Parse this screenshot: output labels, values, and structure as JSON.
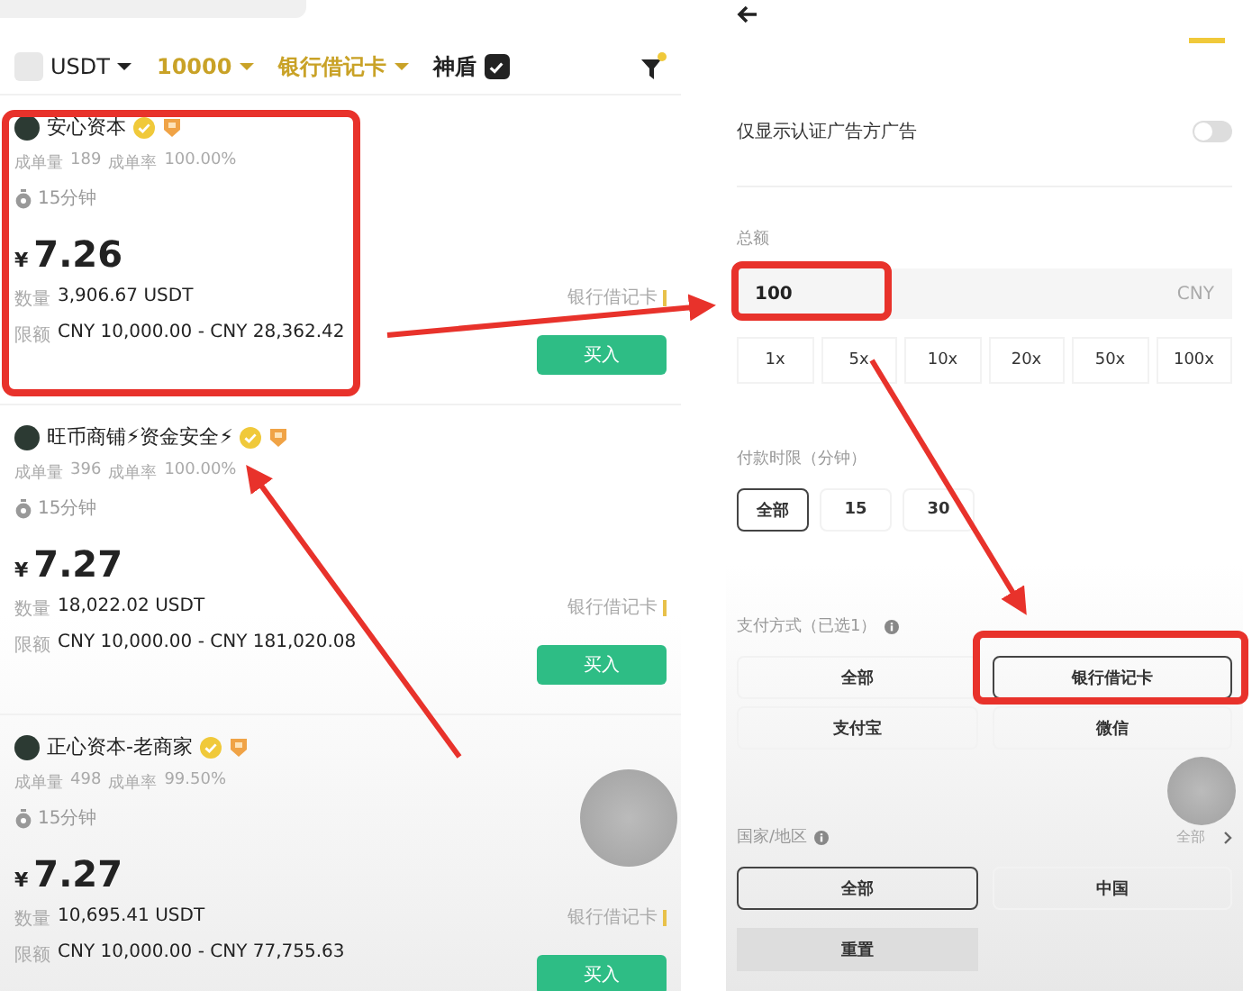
{
  "left": {
    "filter_bar": {
      "coin": "USDT",
      "amount": "10000",
      "payment": "银行借记卡",
      "shield_label": "神盾",
      "shield_checked": true
    },
    "ads": [
      {
        "name": "安心资本",
        "volume_label": "成单量",
        "volume": "189",
        "rate_label": "成单率",
        "rate": "100.00%",
        "time": "15分钟",
        "currency": "¥",
        "price": "7.26",
        "qty_label": "数量",
        "qty": "3,906.67 USDT",
        "limit_label": "限额",
        "limit": "CNY 10,000.00 - CNY 28,362.42",
        "method": "银行借记卡",
        "buy": "买入"
      },
      {
        "name": "旺币商铺⚡资金安全⚡",
        "volume_label": "成单量",
        "volume": "396",
        "rate_label": "成单率",
        "rate": "100.00%",
        "time": "15分钟",
        "currency": "¥",
        "price": "7.27",
        "qty_label": "数量",
        "qty": "18,022.02 USDT",
        "limit_label": "限额",
        "limit": "CNY 10,000.00 - CNY 181,020.08",
        "method": "银行借记卡",
        "buy": "买入"
      },
      {
        "name": "正心资本-老商家",
        "volume_label": "成单量",
        "volume": "498",
        "rate_label": "成单率",
        "rate": "99.50%",
        "time": "15分钟",
        "currency": "¥",
        "price": "7.27",
        "qty_label": "数量",
        "qty": "10,695.41 USDT",
        "limit_label": "限额",
        "limit": "CNY 10,000.00 - CNY 77,755.63",
        "method": "银行借记卡",
        "buy": "买入"
      }
    ]
  },
  "right": {
    "verified_only": {
      "label": "仅显示认证广告方广告",
      "on": false
    },
    "amount": {
      "title": "总额",
      "value": "100",
      "unit": "CNY",
      "multipliers": [
        "1x",
        "5x",
        "10x",
        "20x",
        "50x",
        "100x"
      ]
    },
    "time_limit": {
      "title": "付款时限（分钟）",
      "options": [
        {
          "label": "全部",
          "selected": true
        },
        {
          "label": "15",
          "selected": false
        },
        {
          "label": "30",
          "selected": false
        }
      ]
    },
    "payment": {
      "title": "支付方式（已选1）",
      "options": [
        {
          "label": "全部",
          "selected": false
        },
        {
          "label": "银行借记卡",
          "selected": true
        },
        {
          "label": "支付宝",
          "selected": false
        },
        {
          "label": "微信",
          "selected": false
        }
      ]
    },
    "region": {
      "title": "国家/地区",
      "value": "全部",
      "options": [
        {
          "label": "全部",
          "selected": true
        },
        {
          "label": "中国",
          "selected": false
        }
      ]
    },
    "reset": "重置"
  }
}
